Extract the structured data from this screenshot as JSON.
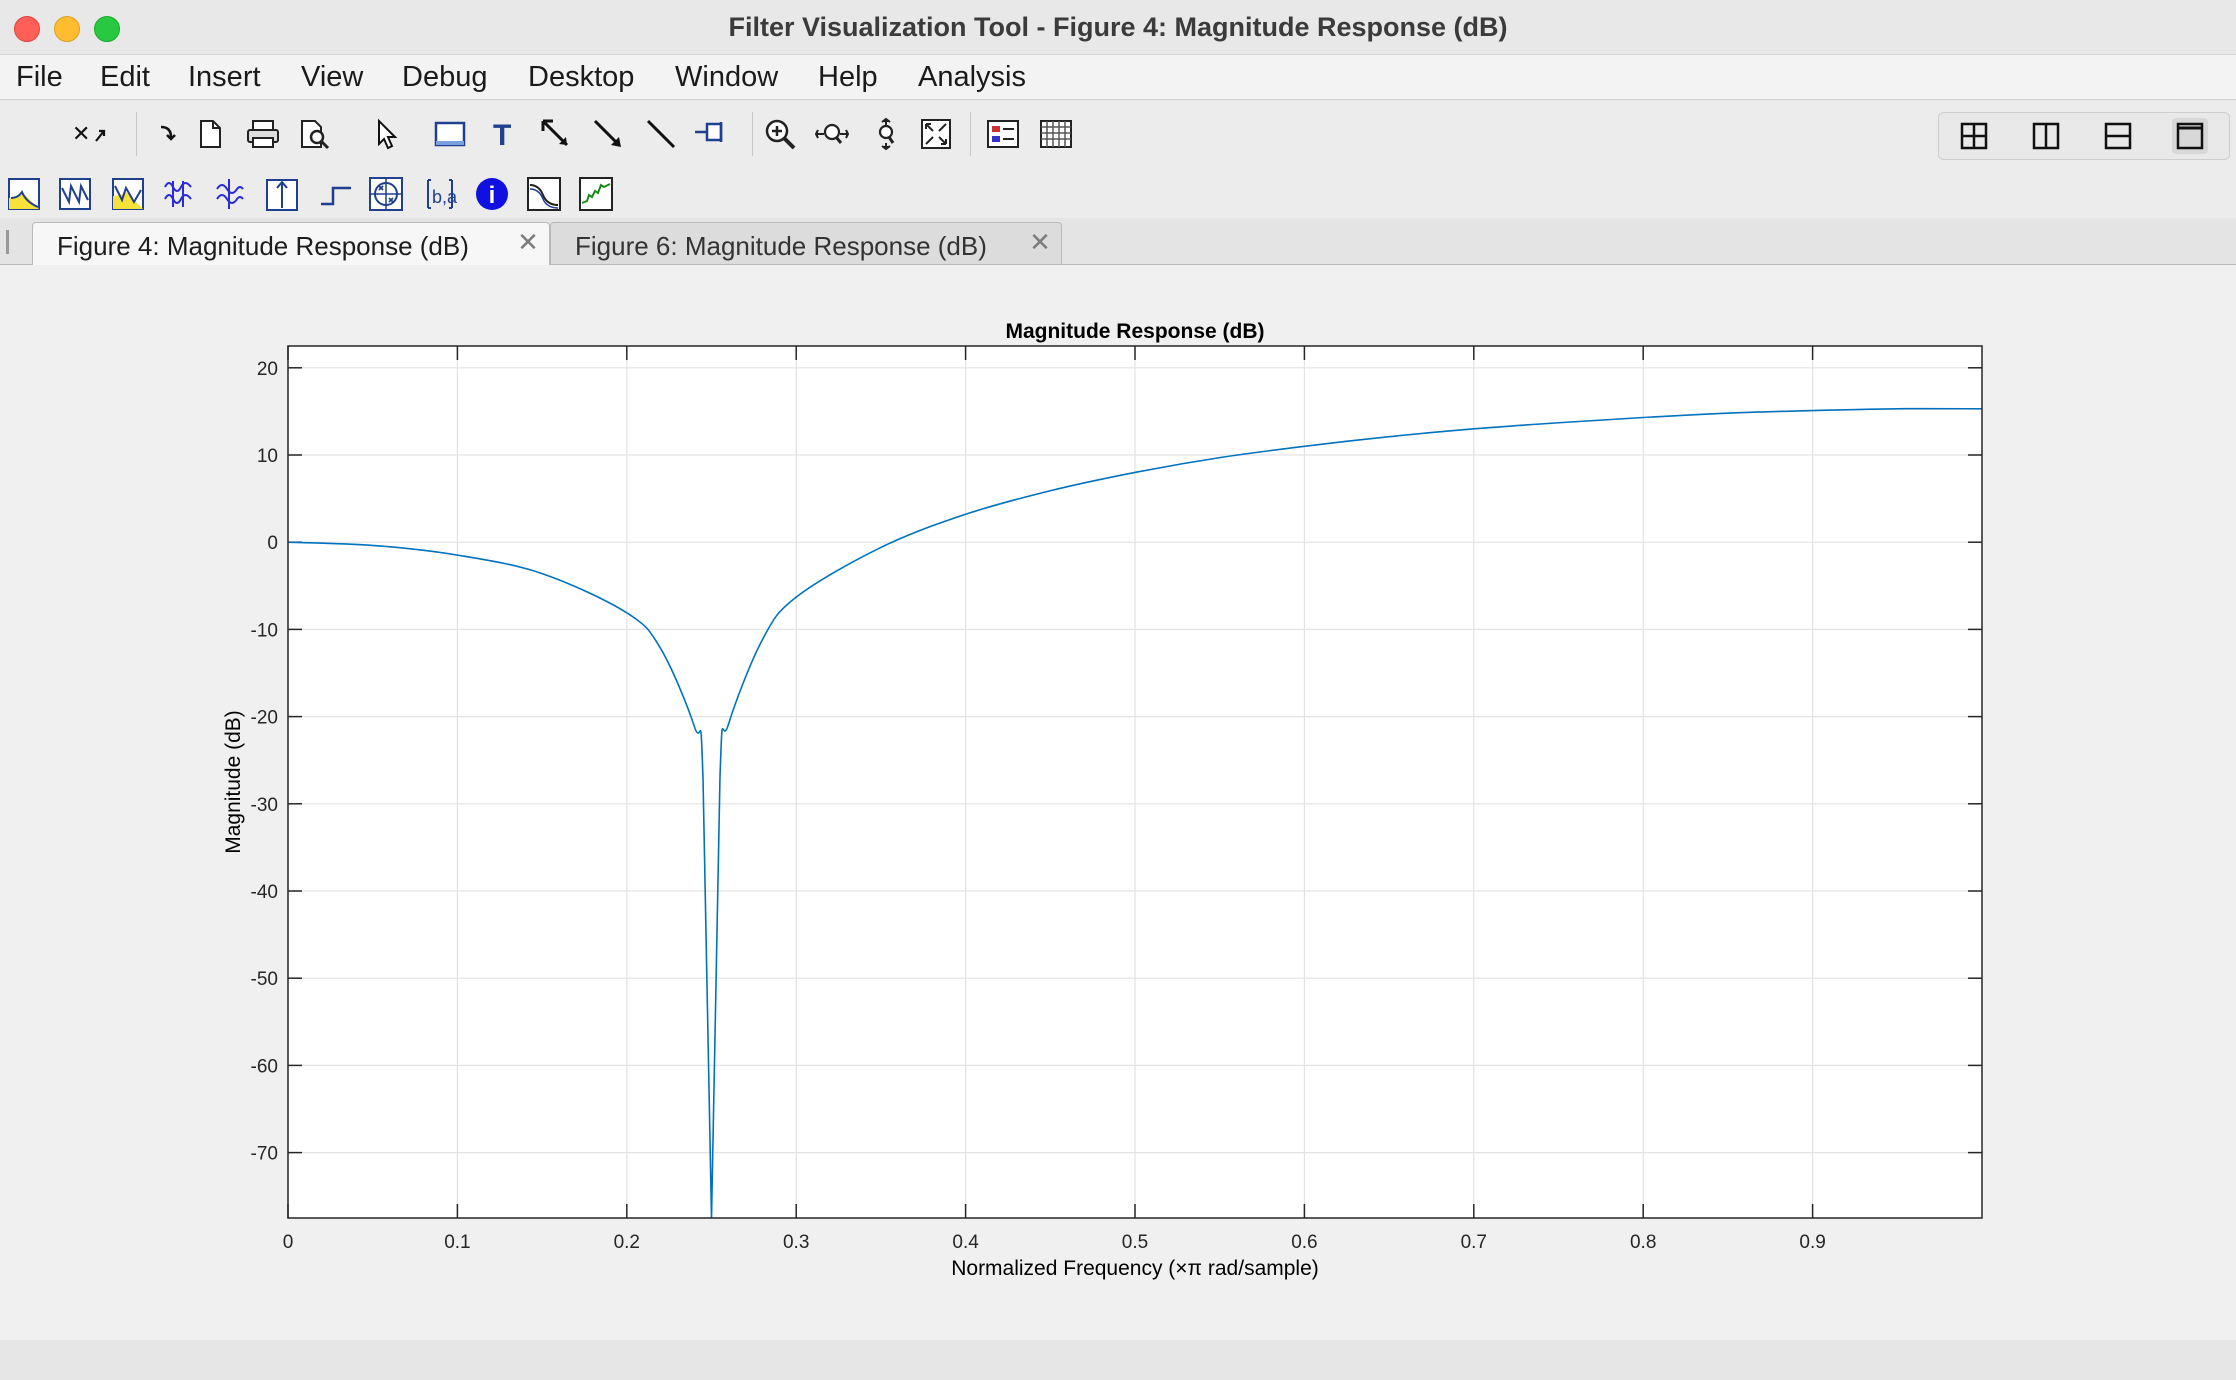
{
  "window": {
    "title": "Filter Visualization Tool - Figure 4: Magnitude Response (dB)"
  },
  "menu": [
    "File",
    "Edit",
    "Insert",
    "View",
    "Debug",
    "Desktop",
    "Window",
    "Help",
    "Analysis"
  ],
  "toolbar1_icons": [
    "undock-icon",
    "new-figure-icon",
    "open-file-icon",
    "print-icon",
    "print-preview-icon",
    "select-pointer-icon",
    "rectangle-icon",
    "text-insert-icon",
    "arrow-icon",
    "double-arrow-icon",
    "line-icon",
    "pin-icon",
    "zoom-in-icon",
    "pan-icon",
    "data-cursor-icon",
    "zoom-fit-icon",
    "legend-icon",
    "grid-icon"
  ],
  "layout_icons": [
    "tile-grid-icon",
    "tile-columns-icon",
    "tile-rows-icon",
    "single-pane-icon"
  ],
  "toolbar2_icons": [
    "magnitude-response-icon",
    "phase-response-icon",
    "magnitude-phase-icon",
    "group-delay-icon",
    "phase-delay-icon",
    "impulse-response-icon",
    "step-response-icon",
    "pole-zero-icon",
    "filter-coefficients-icon",
    "filter-info-icon",
    "magnitude-estimate-icon",
    "round-off-noise-icon"
  ],
  "tabs": [
    {
      "label": "Figure 4: Magnitude Response (dB)",
      "active": true
    },
    {
      "label": "Figure 6: Magnitude Response (dB)",
      "active": false
    }
  ],
  "accent_color": "#0072bd",
  "chart_data": {
    "type": "line",
    "title": "Magnitude Response (dB)",
    "xlabel": "Normalized Frequency (×π rad/sample)",
    "ylabel": "Magnitude (dB)",
    "xlim": [
      0,
      1
    ],
    "ylim": [
      -77.5,
      22.5
    ],
    "xticks": [
      0,
      0.1,
      0.2,
      0.3,
      0.4,
      0.5,
      0.6,
      0.7,
      0.8,
      0.9
    ],
    "xtick_labels": [
      "0",
      "0.1",
      "0.2",
      "0.3",
      "0.4",
      "0.5",
      "0.6",
      "0.7",
      "0.8",
      "0.9"
    ],
    "yticks": [
      20,
      10,
      0,
      -10,
      -20,
      -30,
      -40,
      -50,
      -60,
      -70
    ],
    "ytick_labels": [
      "20",
      "10",
      "0",
      "-10",
      "-20",
      "-30",
      "-40",
      "-50",
      "-60",
      "-70"
    ],
    "grid": true,
    "series": [
      {
        "x": [
          0,
          0.05,
          0.1,
          0.15,
          0.2,
          0.22,
          0.24,
          0.245,
          0.25,
          0.255,
          0.26,
          0.28,
          0.3,
          0.35,
          0.4,
          0.45,
          0.5,
          0.55,
          0.6,
          0.65,
          0.7,
          0.75,
          0.8,
          0.85,
          0.9,
          0.95,
          1.0
        ],
        "y": [
          0,
          -0.37,
          -1.48,
          -3.6,
          -8.1,
          -12.2,
          -21.2,
          -27.2,
          -77.5,
          -27.0,
          -20.9,
          -11.2,
          -6.3,
          -0.6,
          3.2,
          5.9,
          8.0,
          9.7,
          11.0,
          12.1,
          13.0,
          13.7,
          14.3,
          14.8,
          15.1,
          15.3,
          15.3
        ]
      }
    ],
    "color": "#0072bd"
  }
}
